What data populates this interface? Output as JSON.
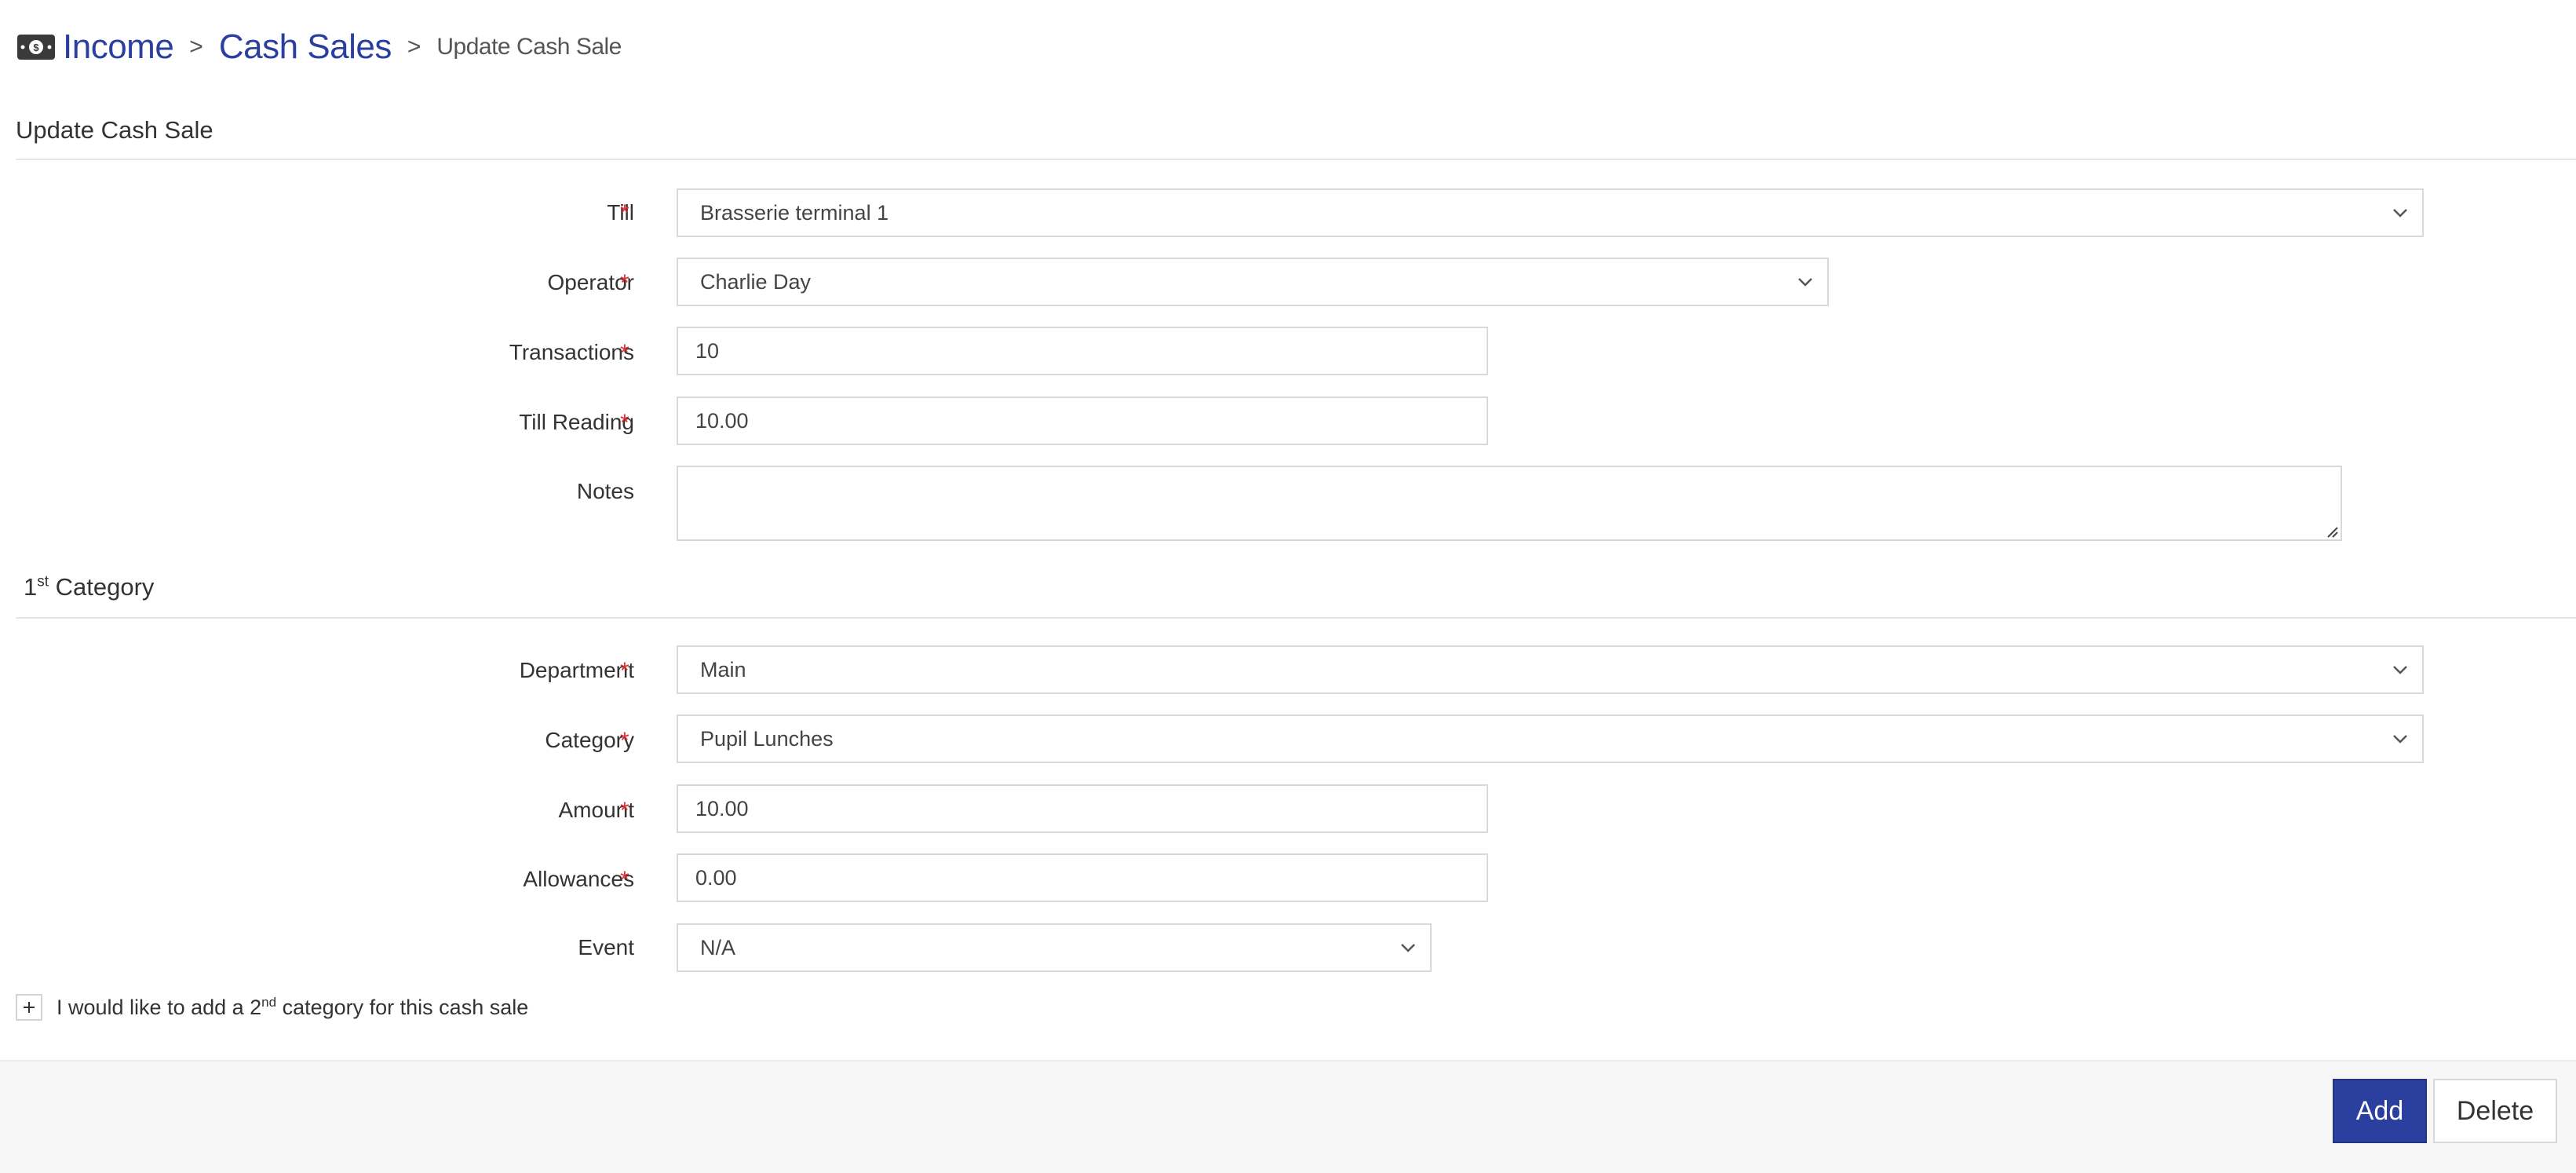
{
  "breadcrumb": {
    "icon": "cash-icon",
    "income": "Income",
    "cash_sales": "Cash Sales",
    "current": "Update Cash Sale",
    "separator": ">"
  },
  "section_update": {
    "title": "Update Cash Sale"
  },
  "form": {
    "till": {
      "label": "Till",
      "value": "Brasserie terminal 1"
    },
    "operator": {
      "label": "Operator",
      "value": "Charlie Day"
    },
    "transactions": {
      "label": "Transactions",
      "value": "10"
    },
    "till_reading": {
      "label": "Till Reading",
      "value": "10.00"
    },
    "notes": {
      "label": "Notes",
      "value": ""
    }
  },
  "category_section": {
    "title_num": "1",
    "title_sup": "st",
    "title_text": " Category"
  },
  "category": {
    "department": {
      "label": "Department",
      "value": "Main"
    },
    "category": {
      "label": "Category",
      "value": "Pupil Lunches"
    },
    "amount": {
      "label": "Amount",
      "value": "10.00"
    },
    "allowances": {
      "label": "Allowances",
      "value": "0.00"
    },
    "event": {
      "label": "Event",
      "value": "N/A"
    }
  },
  "add_category": {
    "text_before": "I would like to add a 2",
    "text_sup": "nd",
    "text_after": " category for this cash sale"
  },
  "required_marker": "*",
  "buttons": {
    "add": "Add",
    "delete": "Delete"
  },
  "colors": {
    "brand": "#2b3f9e",
    "required": "#e03030"
  }
}
